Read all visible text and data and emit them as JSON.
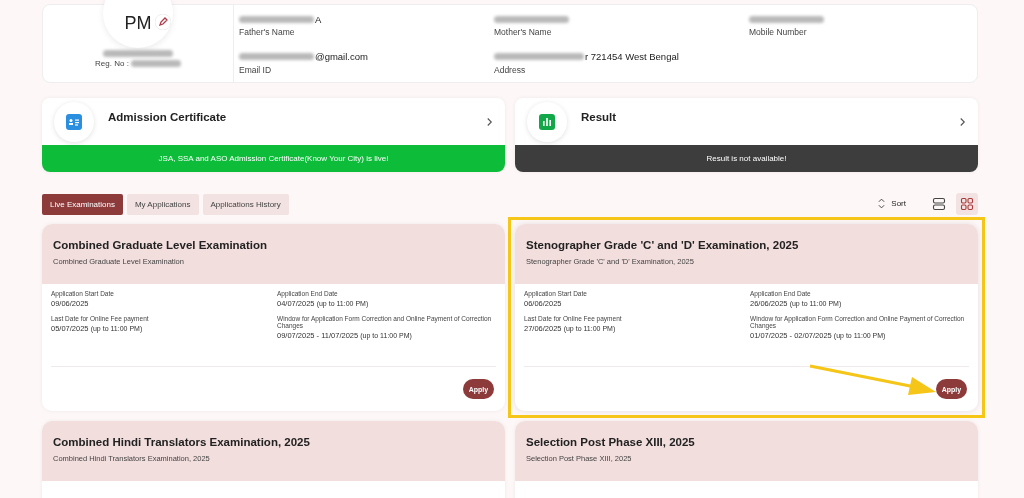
{
  "profile": {
    "initials": "PM",
    "name_redacted": true,
    "reg_label": "Reg. No :",
    "reg_redacted": true,
    "fields": [
      {
        "label": "Father's Name",
        "value": "A",
        "redacted": true
      },
      {
        "label": "Mother's Name",
        "redacted": true
      },
      {
        "label": "Mobile Number",
        "redacted": true
      },
      {
        "label": "Email ID",
        "value": "@gmail.com",
        "redacted": true
      },
      {
        "label": "Address",
        "value": "r 721454 West Bengal",
        "redacted": true
      }
    ]
  },
  "services": [
    {
      "kind": "admission",
      "title": "Admission Certificate",
      "banner": "JSA, SSA and ASO Admission Certificate(Know Your City) is live!"
    },
    {
      "kind": "result",
      "title": "Result",
      "banner": "Result is not available!"
    }
  ],
  "tabs": [
    {
      "label": "Live Examinations",
      "selected": true
    },
    {
      "label": "My Applications",
      "selected": false
    },
    {
      "label": "Applications History",
      "selected": false
    }
  ],
  "sort_label": "Sort",
  "views": [
    {
      "kind": "list",
      "selected": false
    },
    {
      "kind": "grid",
      "selected": true
    }
  ],
  "exams": [
    {
      "title": "Combined Graduate Level Examination",
      "subtitle": "Combined Graduate Level Examination",
      "highlighted": false,
      "action": "Apply",
      "dates": [
        {
          "label": "Application Start Date",
          "value": "09/06/2025"
        },
        {
          "label": "Application End Date",
          "value": "04/07/2025",
          "note": "(up to 11:00 PM)"
        },
        {
          "label": "Last Date for Online Fee payment",
          "value": "05/07/2025",
          "note": "(up to 11:00 PM)"
        },
        {
          "label": "Window for Application Form Correction and Online Payment of Correction Changes",
          "value": "09/07/2025 - 11/07/2025",
          "note": "(up to 11:00 PM)"
        }
      ]
    },
    {
      "title": "Stenographer Grade 'C' and 'D' Examination, 2025",
      "subtitle": "Stenographer Grade 'C' and 'D' Examination, 2025",
      "highlighted": true,
      "action": "Apply",
      "dates": [
        {
          "label": "Application Start Date",
          "value": "06/06/2025"
        },
        {
          "label": "Application End Date",
          "value": "26/06/2025",
          "note": "(up to 11:00 PM)"
        },
        {
          "label": "Last Date for Online Fee payment",
          "value": "27/06/2025",
          "note": "(up to 11:00 PM)"
        },
        {
          "label": "Window for Application Form Correction and Online Payment of Correction Changes",
          "value": "01/07/2025 - 02/07/2025",
          "note": "(up to 11:00 PM)"
        }
      ]
    },
    {
      "title": "Combined Hindi Translators Examination, 2025",
      "subtitle": "Combined Hindi Translators Examination, 2025",
      "highlighted": false
    },
    {
      "title": "Selection Post Phase XIII, 2025",
      "subtitle": "Selection Post Phase XIII, 2025",
      "highlighted": false
    }
  ]
}
